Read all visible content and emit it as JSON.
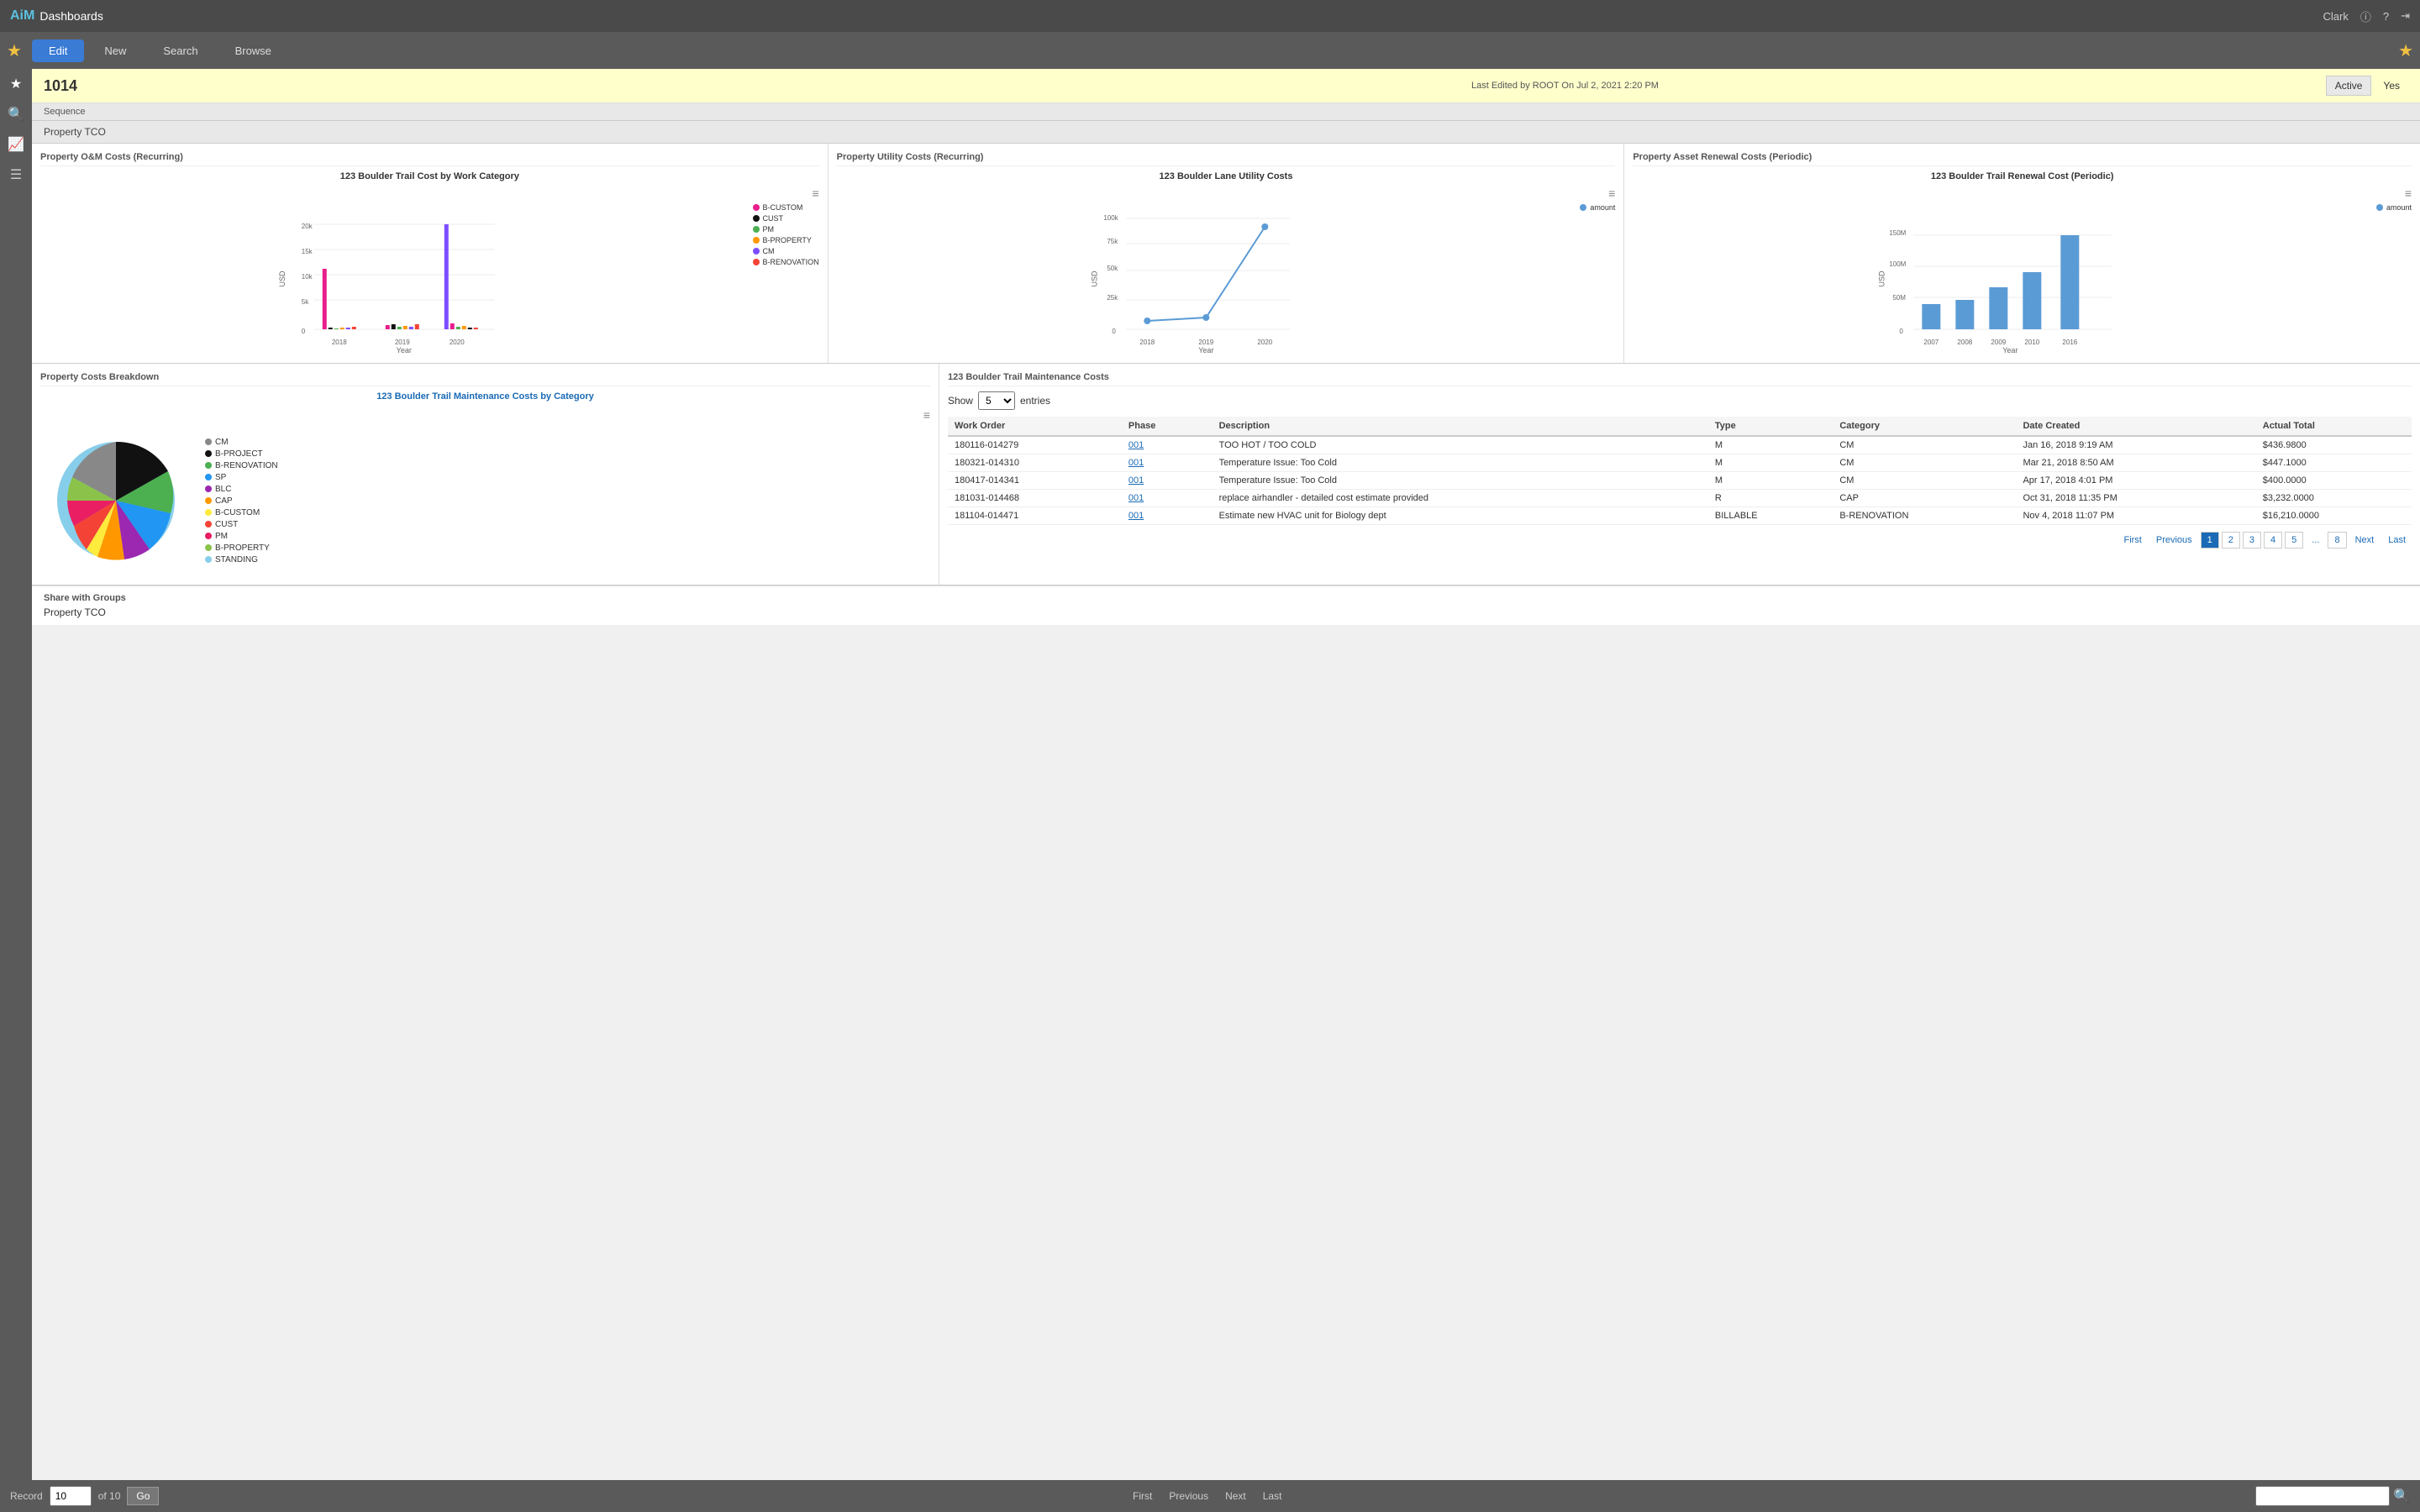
{
  "app": {
    "brand": "AiM",
    "brand_sub": "Dashboards",
    "user": "Clark"
  },
  "action_bar": {
    "edit_label": "Edit",
    "new_label": "New",
    "search_label": "Search",
    "browse_label": "Browse"
  },
  "record": {
    "id": "1014",
    "last_edited": "Last Edited by ROOT On Jul 2, 2021 2:20 PM",
    "active_label": "Active",
    "active_value": "Yes",
    "sequence_label": "Sequence"
  },
  "section_label": "Property TCO",
  "charts": {
    "om_title": "Property O&M Costs (Recurring)",
    "utility_title": "Property Utility Costs (Recurring)",
    "renewal_title": "Property Asset Renewal Costs (Periodic)",
    "om_chart_title": "123 Boulder Trail Cost by Work Category",
    "utility_chart_title": "123 Boulder Lane Utility Costs",
    "renewal_chart_title": "123 Boulder Trail Renewal Cost (Periodic)",
    "om_legend": [
      {
        "label": "B-CUSTOM",
        "color": "#e91e8c"
      },
      {
        "label": "CUST",
        "color": "#111111"
      },
      {
        "label": "PM",
        "color": "#4caf50"
      },
      {
        "label": "B-PROPERTY",
        "color": "#ff9800"
      },
      {
        "label": "CM",
        "color": "#7c4dff"
      },
      {
        "label": "B-RENOVATION",
        "color": "#f44336"
      }
    ],
    "renewal_legend": [
      {
        "label": "amount",
        "color": "#5b9bd5"
      }
    ],
    "utility_legend": [
      {
        "label": "amount",
        "color": "#5b9bd5"
      }
    ]
  },
  "breakdown": {
    "title": "Property Costs Breakdown",
    "chart_title": "123 Boulder Trail Maintenance Costs by Category",
    "legend": [
      {
        "label": "CM",
        "color": "#888888"
      },
      {
        "label": "B-PROJECT",
        "color": "#111111"
      },
      {
        "label": "B-RENOVATION",
        "color": "#4caf50"
      },
      {
        "label": "SP",
        "color": "#2196f3"
      },
      {
        "label": "BLC",
        "color": "#9c27b0"
      },
      {
        "label": "CAP",
        "color": "#ff9800"
      },
      {
        "label": "B-CUSTOM",
        "color": "#ffeb3b"
      },
      {
        "label": "CUST",
        "color": "#f44336"
      },
      {
        "label": "PM",
        "color": "#e91e63"
      },
      {
        "label": "B-PROPERTY",
        "color": "#8bc34a"
      },
      {
        "label": "STANDING",
        "color": "#87ceeb"
      }
    ]
  },
  "maintenance": {
    "title": "123 Boulder Trail Maintenance Costs",
    "show_label": "Show",
    "entries_label": "entries",
    "show_value": "5",
    "columns": [
      "Work Order",
      "Phase",
      "Description",
      "Type",
      "Category",
      "Date Created",
      "Actual Total"
    ],
    "rows": [
      {
        "work_order": "180116-014279",
        "phase": "001",
        "description": "TOO HOT / TOO COLD",
        "type": "M",
        "category": "CM",
        "date_created": "Jan 16, 2018 9:19 AM",
        "actual_total": "$436.9800"
      },
      {
        "work_order": "180321-014310",
        "phase": "001",
        "description": "Temperature Issue: Too Cold",
        "type": "M",
        "category": "CM",
        "date_created": "Mar 21, 2018 8:50 AM",
        "actual_total": "$447.1000"
      },
      {
        "work_order": "180417-014341",
        "phase": "001",
        "description": "Temperature Issue: Too Cold",
        "type": "M",
        "category": "CM",
        "date_created": "Apr 17, 2018 4:01 PM",
        "actual_total": "$400.0000"
      },
      {
        "work_order": "181031-014468",
        "phase": "001",
        "description": "replace airhandler - detailed cost estimate provided",
        "type": "R",
        "category": "CAP",
        "date_created": "Oct 31, 2018 11:35 PM",
        "actual_total": "$3,232.0000"
      },
      {
        "work_order": "181104-014471",
        "phase": "001",
        "description": "Estimate new HVAC unit for Biology dept",
        "type": "BILLABLE",
        "category": "B-RENOVATION",
        "date_created": "Nov 4, 2018 11:07 PM",
        "actual_total": "$16,210.0000"
      }
    ],
    "pagination": {
      "first": "First",
      "previous": "Previous",
      "next": "Next",
      "last": "Last",
      "pages": [
        "1",
        "2",
        "3",
        "4",
        "5",
        "...",
        "8"
      ],
      "active_page": "1"
    }
  },
  "share": {
    "title": "Share with Groups",
    "value": "Property TCO"
  },
  "bottom_bar": {
    "record_label": "Record",
    "record_value": "10",
    "of_label": "of 10",
    "go_label": "Go",
    "first": "First",
    "previous": "Previous",
    "next": "Next",
    "last": "Last"
  }
}
